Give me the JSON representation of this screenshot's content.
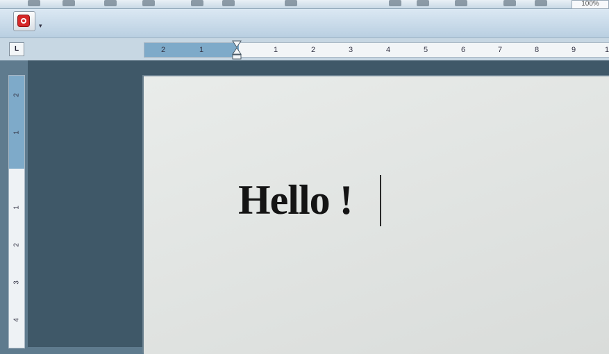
{
  "toolbar": {
    "zoom_value": "100%",
    "stop_button": "stop-icon",
    "dropdown_arrow": "chevron-down-icon"
  },
  "ruler": {
    "tab_selector": "L",
    "horizontal_labels": [
      "2",
      "1",
      "1",
      "2",
      "3",
      "4",
      "5",
      "6",
      "7",
      "8",
      "9",
      "1"
    ],
    "vertical_labels": [
      "2",
      "1",
      "1",
      "2",
      "3",
      "4"
    ]
  },
  "document": {
    "text": "Hello !"
  }
}
